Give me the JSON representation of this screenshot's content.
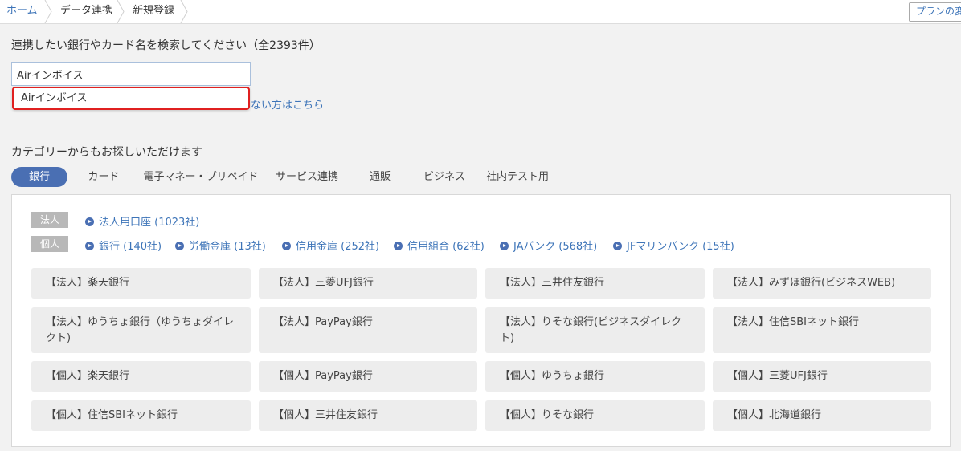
{
  "breadcrumb": {
    "home": "ホーム",
    "item1": "データ連携",
    "item2": "新規登録"
  },
  "plan_button": "プランの変",
  "search": {
    "label": "連携したい銀行やカード名を検索してください（全2393件）",
    "value": "Airインボイス",
    "suggestion": "Airインボイス",
    "not_found_link": "ない方はこちら"
  },
  "categories": {
    "label": "カテゴリーからもお探しいただけます",
    "tabs": [
      "銀行",
      "カード",
      "電子マネー・プリペイド",
      "サービス連携",
      "通販",
      "ビジネス",
      "社内テスト用"
    ],
    "active_tab": "銀行"
  },
  "panel": {
    "corp_tag": "法人",
    "personal_tag": "個人",
    "corp_links": [
      "法人用口座 (1023社)"
    ],
    "personal_links": [
      "銀行 (140社)",
      "労働金庫 (13社)",
      "信用金庫 (252社)",
      "信用組合 (62社)",
      "JAバンク (568社)",
      "JFマリンバンク (15社)"
    ],
    "banks": [
      "【法人】楽天銀行",
      "【法人】三菱UFJ銀行",
      "【法人】三井住友銀行",
      "【法人】みずほ銀行(ビジネスWEB)",
      "【法人】ゆうちょ銀行（ゆうちょダイレクト)",
      "【法人】PayPay銀行",
      "【法人】りそな銀行(ビジネスダイレクト)",
      "【法人】住信SBIネット銀行",
      "【個人】楽天銀行",
      "【個人】PayPay銀行",
      "【個人】ゆうちょ銀行",
      "【個人】三菱UFJ銀行",
      "【個人】住信SBIネット銀行",
      "【個人】三井住友銀行",
      "【個人】りそな銀行",
      "【個人】北海道銀行"
    ]
  },
  "colors": {
    "accent": "#4a6fb3",
    "link": "#3d74b8",
    "highlight_border": "#e02020"
  },
  "icons": {
    "link_bullet": "play-circle-icon",
    "breadcrumb_separator": "chevron-right-icon"
  }
}
